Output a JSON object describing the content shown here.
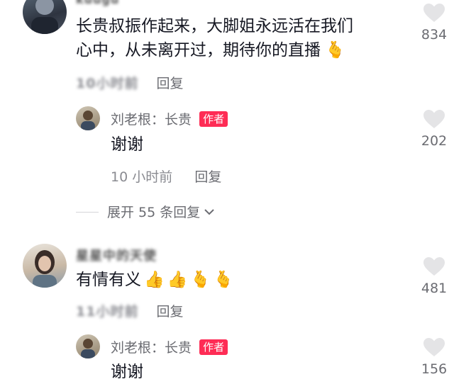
{
  "comments": [
    {
      "username": "kuugu",
      "text_line1": "长贵叔振作起来，大脚姐永远活在我们",
      "text_line2": "心中，从未离开过，期待你的直播",
      "emoji": "🫰",
      "time": "10小时前",
      "reply_label": "回复",
      "likes": "834",
      "reply": {
        "name": "刘老根：长贵",
        "badge": "作者",
        "text": "谢谢",
        "time": "10 小时前",
        "reply_label": "回复",
        "likes": "202"
      },
      "expand_label": "展开 55 条回复"
    },
    {
      "username": "星星中的天使",
      "text": "有情有义",
      "emojis": "👍👍🫰🫰",
      "time": "11小时前",
      "reply_label": "回复",
      "likes": "481",
      "reply": {
        "name": "刘老根：长贵",
        "badge": "作者",
        "text": "谢谢",
        "likes": "156"
      }
    }
  ],
  "colors": {
    "author_badge": "#fe2c55",
    "muted": "#8a8b91",
    "heart": "#e4e4e6"
  },
  "icons": {
    "like": "heart-icon",
    "expand": "chevron-down-icon"
  }
}
